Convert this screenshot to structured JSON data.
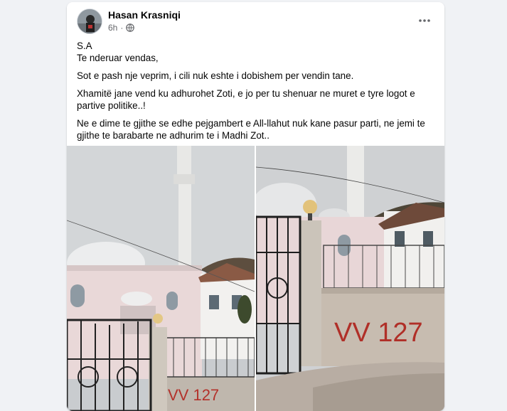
{
  "post": {
    "author": "Hasan Krasniqi",
    "time": "6h",
    "more_icon": "more-horizontal-icon",
    "audience_icon": "globe-icon",
    "lines": [
      "S.A",
      "Te nderuar vendas,",
      "Sot e pash nje veprim, i cili nuk eshte i dobishem per vendin tane.",
      "Xhamitë jane vend ku adhurohet Zoti, e jo per tu shenuar ne muret e tyre logot e partive politike..!",
      "Ne e dime te gjithe se edhe pejgambert e All-llahut nuk kane pasur parti, ne jemi te gjithe te barabarte ne adhurim te i Madhi Zot.."
    ],
    "graffiti_text": "VV 127"
  },
  "colors": {
    "page_bg": "#f0f2f5",
    "card_bg": "#ffffff",
    "meta_gray": "#65676b"
  }
}
